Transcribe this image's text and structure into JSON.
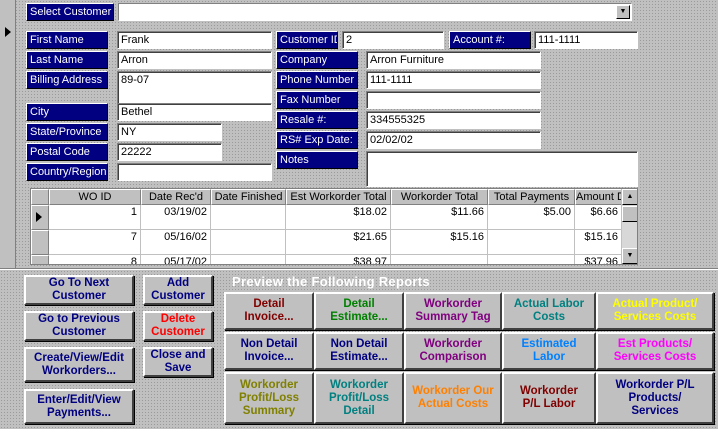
{
  "header": {
    "select_customer_label": "Select Customer",
    "select_customer_value": ""
  },
  "customer": {
    "first_name_label": "First Name",
    "first_name": "Frank",
    "last_name_label": "Last Name",
    "last_name": "Arron",
    "billing_address_label": "Billing Address",
    "billing_address": "89-07",
    "city_label": "City",
    "city": "Bethel",
    "state_label": "State/Province",
    "state": "NY",
    "postal_code_label": "Postal Code",
    "postal_code": "22222",
    "country_label": "Country/Region",
    "country": "",
    "customer_id_label": "Customer ID",
    "customer_id": "2",
    "account_label": "Account #:",
    "account": "111-1111",
    "company_label": "Company",
    "company": "Arron Furniture",
    "phone_label": "Phone Number",
    "phone": "111-1111",
    "fax_label": "Fax Number",
    "fax": "",
    "resale_label": "Resale #:",
    "resale": "334555325",
    "rs_exp_label": "RS# Exp Date:",
    "rs_exp": "02/02/02",
    "notes_label": "Notes",
    "notes": ""
  },
  "workorders": {
    "columns": [
      "WO ID",
      "Date Rec'd",
      "Date Finished",
      "Est Workorder Total",
      "Workorder Total",
      "Total Payments",
      "Amount Due"
    ],
    "rows": [
      [
        "1",
        "03/19/02",
        "",
        "$18.02",
        "$11.66",
        "$5.00",
        "$6.66"
      ],
      [
        "7",
        "05/16/02",
        "",
        "$21.65",
        "$15.16",
        "",
        "$15.16"
      ],
      [
        "8",
        "05/17/02",
        "",
        "$38.97",
        "",
        "",
        "$37.96"
      ]
    ]
  },
  "nav_buttons": {
    "next": "Go To Next\nCustomer",
    "prev": "Go to Previous\nCustomer",
    "workorders": "Create/View/Edit\nWorkorders...",
    "payments": "Enter/Edit/View\nPayments...",
    "add": "Add\nCustomer",
    "delete": "Delete\nCustomer",
    "close": "Close and\nSave"
  },
  "reports": {
    "title": "Preview the Following Reports",
    "detail_invoice": "Detail\nInvoice...",
    "detail_estimate": "Detail\nEstimate...",
    "wo_summary_tag": "Workorder\nSummary Tag",
    "actual_labor": "Actual Labor\nCosts",
    "actual_product": "Actual Product/\nServices Costs",
    "nondetail_invoice": "Non Detail\nInvoice...",
    "nondetail_estimate": "Non Detail\nEstimate...",
    "wo_comparison": "Workorder\nComparison",
    "est_labor": "Estimated\nLabor",
    "est_products": "Est Products/\nServices Costs",
    "wo_pl_summary": "Workorder\nProfit/Loss\nSummary",
    "wo_pl_detail": "Workorder\nProfit/Loss\nDetail",
    "wo_actual_costs": "Workorder Our\nActual Costs",
    "wo_pl_labor": "Workorder\nP/L Labor",
    "wo_pl_products": "Workorder P/L\nProducts/\nServices"
  },
  "colors": {
    "label_bg": "#000080",
    "detail_invoice": "#800000",
    "detail_estimate": "#008000",
    "wo_summary_tag": "#800080",
    "actual_labor": "#008080",
    "actual_product": "#ffff00",
    "nondetail": "#000080",
    "wo_comparison": "#800080",
    "est_labor": "#0080ff",
    "est_products": "#ff00ff",
    "wo_pl_summary": "#808000",
    "wo_pl_detail": "#008080",
    "wo_actual_costs": "#ff8000",
    "wo_pl_labor": "#800000",
    "wo_pl_products": "#000080"
  }
}
